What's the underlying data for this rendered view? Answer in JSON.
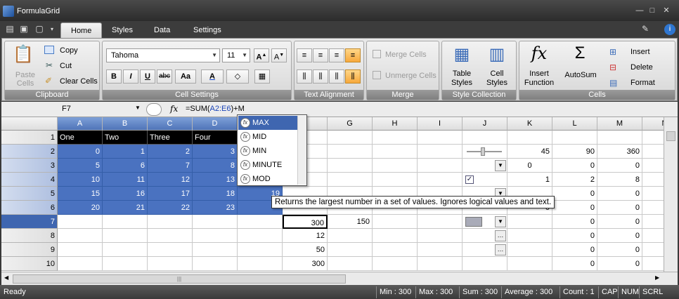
{
  "window": {
    "title": "FormulaGrid",
    "controls": [
      "—",
      "□",
      "✕"
    ]
  },
  "tabs": [
    "Home",
    "Styles",
    "Data",
    "Settings"
  ],
  "ribbon": {
    "clipboard": {
      "paste": "Paste\nCells",
      "copy": "Copy",
      "cut": "Cut",
      "clear": "Clear Cells",
      "label": "Clipboard"
    },
    "cell_settings": {
      "font": "Tahoma",
      "size": "11",
      "bold": "B",
      "italic": "I",
      "underline": "U",
      "strike": "abc",
      "case": "Aa",
      "font_color": "A",
      "label": "Cell Settings"
    },
    "text_alignment": {
      "label": "Text Alignment"
    },
    "merge": {
      "merge_cells": "Merge Cells",
      "unmerge_cells": "Unmerge Cells",
      "label": "Merge"
    },
    "style_collection": {
      "table_styles": "Table\nStyles",
      "cell_styles": "Cell\nStyles",
      "label": "Style Collection"
    },
    "cells": {
      "insert_function": "Insert\nFunction",
      "autosum": "AutoSum",
      "insert": "Insert",
      "delete": "Delete",
      "format": "Format",
      "label": "Cells"
    }
  },
  "formula_bar": {
    "name_box": "F7",
    "fx": "fx",
    "formula_prefix": "=SUM(",
    "formula_ref": "A2:E6",
    "formula_suffix": ")+M"
  },
  "columns": [
    "A",
    "B",
    "C",
    "D",
    "E",
    "F",
    "G",
    "H",
    "I",
    "J",
    "K",
    "L",
    "M",
    "N"
  ],
  "rows": [
    "1",
    "2",
    "3",
    "4",
    "5",
    "6",
    "7",
    "8",
    "9",
    "10"
  ],
  "cells": {
    "header_row": [
      "One",
      "Two",
      "Three",
      "Four"
    ],
    "A": [
      "0",
      "5",
      "10",
      "15",
      "20"
    ],
    "B": [
      "1",
      "6",
      "11",
      "16",
      "21"
    ],
    "C": [
      "2",
      "7",
      "12",
      "17",
      "22"
    ],
    "D": [
      "3",
      "8",
      "13",
      "18",
      "23"
    ],
    "E5": "19",
    "F": [
      "300",
      "12",
      "50",
      "300"
    ],
    "G7": "150",
    "K": [
      "45",
      "0",
      "1",
      "0"
    ],
    "L": [
      "90",
      "0",
      "2",
      "0",
      "0",
      "0",
      "0",
      "0",
      "0"
    ],
    "M": [
      "360",
      "0",
      "8",
      "0",
      "0",
      "0",
      "0",
      "0",
      "0"
    ]
  },
  "autocomplete": {
    "items": [
      "MAX",
      "MID",
      "MIN",
      "MINUTE",
      "MOD"
    ],
    "selected": 0
  },
  "tooltip": "Returns the largest number in a set of values. Ignores logical values and text.",
  "status": {
    "ready": "Ready",
    "min": "Min : 300",
    "max": "Max : 300",
    "sum": "Sum : 300",
    "average": "Average : 300",
    "count": "Count : 1",
    "cap": "CAP",
    "num": "NUM",
    "scrl": "SCRL"
  },
  "hscroll_grip": "|||"
}
